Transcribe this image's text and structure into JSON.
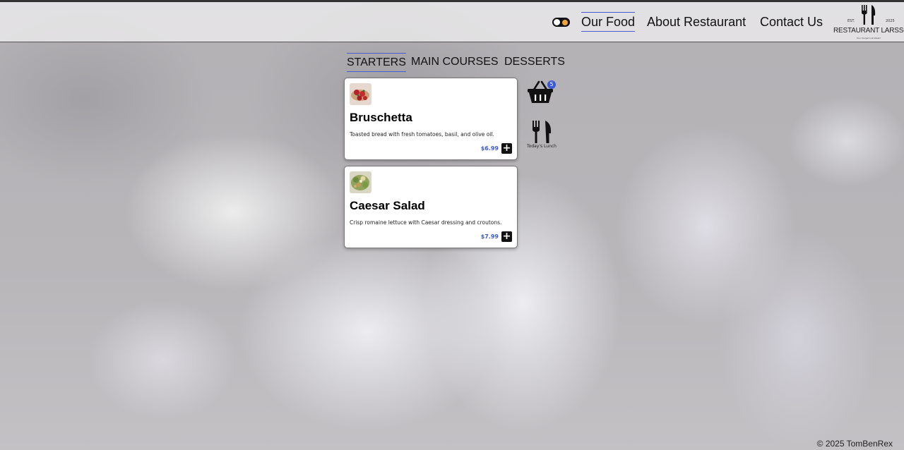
{
  "header": {
    "nav": [
      {
        "label": "Our Food",
        "active": true
      },
      {
        "label": "About Restaurant",
        "active": false
      },
      {
        "label": "Contact Us",
        "active": false
      }
    ],
    "logo": {
      "est": "EST.",
      "year": "2025",
      "name": "RESTAURANT LARSSON",
      "tagline": "Your burger's at steak!"
    }
  },
  "tabs": [
    {
      "label": "STARTERS",
      "active": true
    },
    {
      "label": "MAIN COURSES",
      "active": false
    },
    {
      "label": "DESSERTS",
      "active": false
    }
  ],
  "menu_items": [
    {
      "title": "Bruschetta",
      "description": "Toasted bread with fresh tomatoes, basil, and olive oil.",
      "price": "$6.99",
      "add_label": "+"
    },
    {
      "title": "Caesar Salad",
      "description": "Crisp romaine lettuce with Caesar dressing and croutons.",
      "price": "$7.99",
      "add_label": "+"
    }
  ],
  "cart": {
    "count": "5"
  },
  "lunch": {
    "label": "Today's Lunch"
  },
  "footer": {
    "copyright": "© 2025 TomBenRex"
  },
  "colors": {
    "accent": "#3b59d6",
    "toggle_sun": "#f2a53a"
  }
}
